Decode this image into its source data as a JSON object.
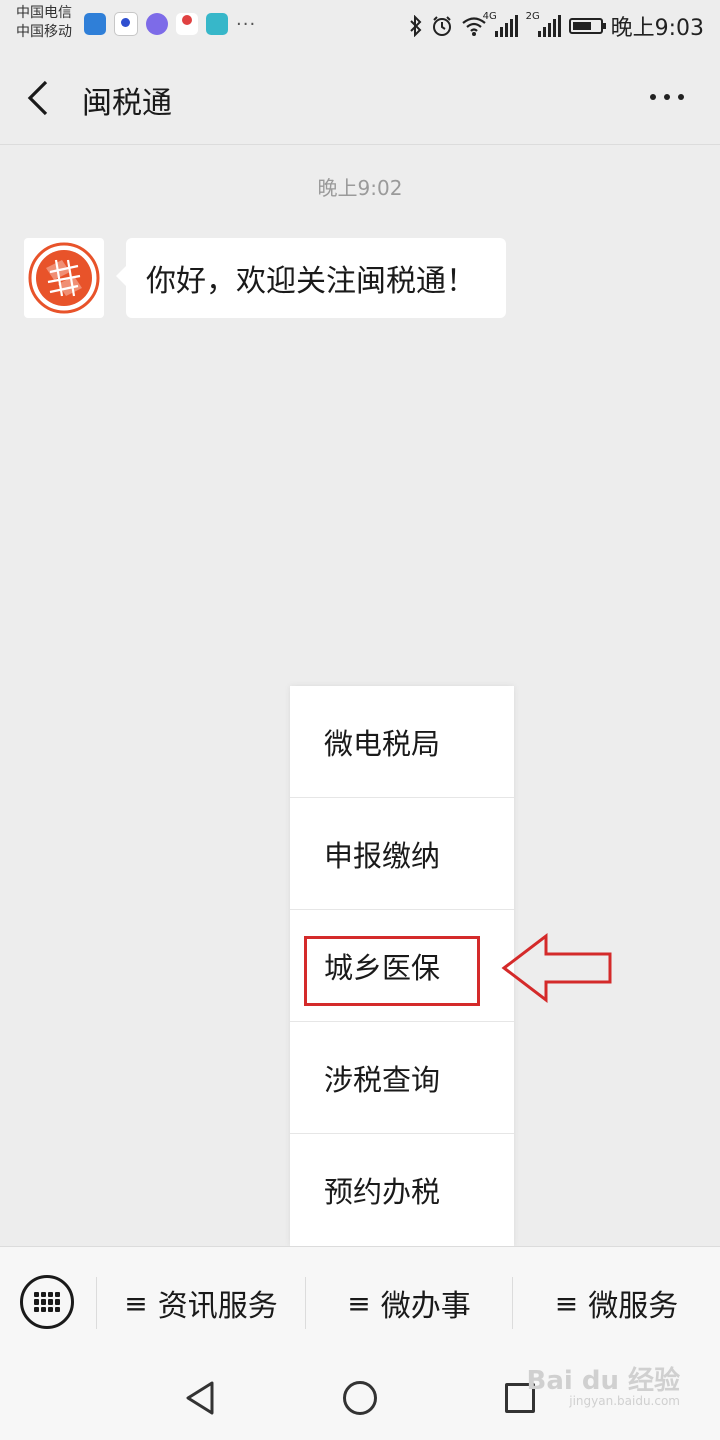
{
  "status_bar": {
    "carrier_1": "中国电信",
    "carrier_2": "中国移动",
    "network_tag_1": "4G",
    "network_tag_2": "2G",
    "time": "晚上9:03",
    "notification_more": "···"
  },
  "header": {
    "title": "闽税通"
  },
  "chat": {
    "timestamp": "晚上9:02",
    "message": "你好，欢迎关注闽税通！"
  },
  "popup_menu": {
    "items": [
      "微电税局",
      "申报缴纳",
      "城乡医保",
      "涉税查询",
      "预约办税"
    ],
    "highlighted_index": 2
  },
  "bottom_menu": {
    "tabs": [
      "资讯服务",
      "微办事",
      "微服务"
    ],
    "menu_glyph": "≡"
  },
  "watermark": {
    "text": "Bai du 经验",
    "url": "jingyan.baidu.com"
  },
  "colors": {
    "background": "#ededed",
    "annotation_red": "#d42a2a",
    "avatar_orange": "#e8532a"
  }
}
